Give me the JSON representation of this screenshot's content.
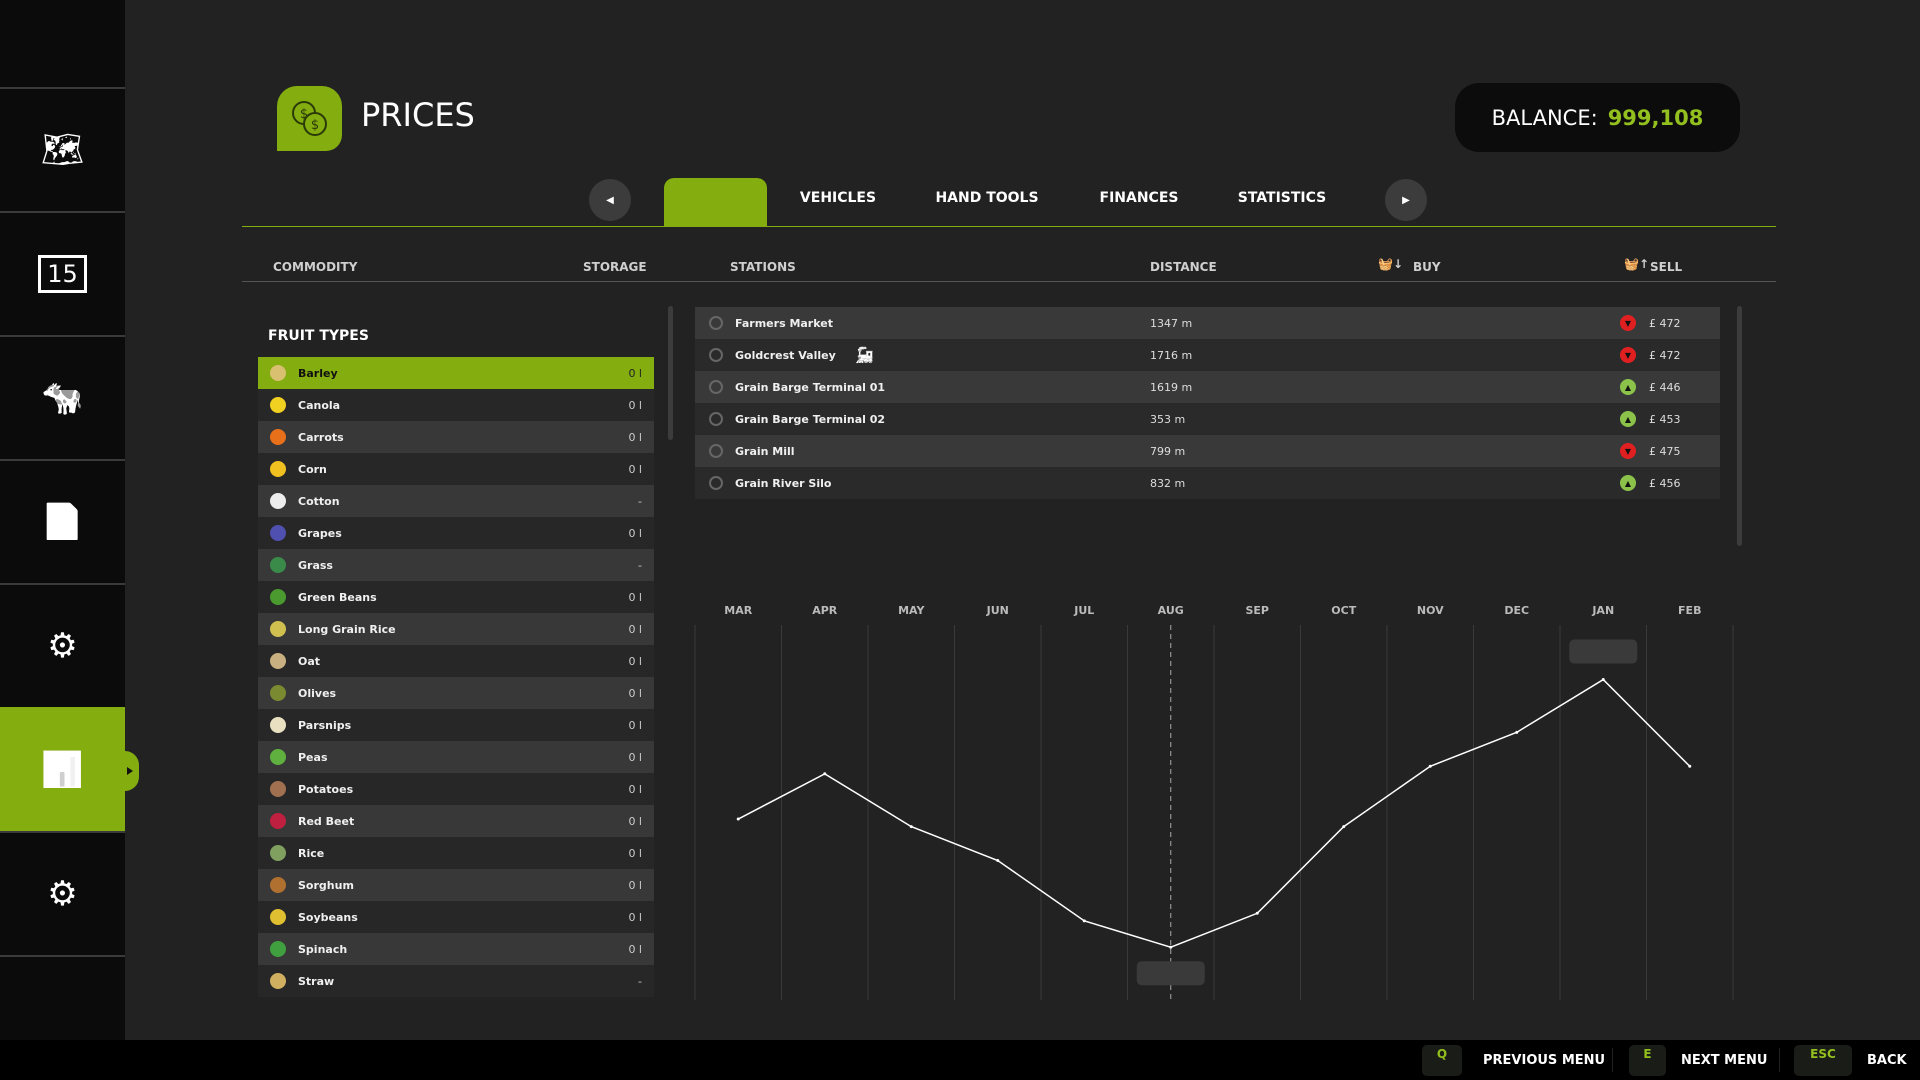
{
  "sidebar": {
    "items": [
      {
        "name": "map",
        "icon": "map-pin-icon",
        "glyph": "🗺"
      },
      {
        "name": "calendar",
        "icon": "calendar-icon",
        "glyph": "15"
      },
      {
        "name": "animals",
        "icon": "cow-icon",
        "glyph": "🐄"
      },
      {
        "name": "contracts",
        "icon": "documents-icon",
        "glyph": "📄"
      },
      {
        "name": "production",
        "icon": "factory-icon",
        "glyph": "⚙"
      },
      {
        "name": "prices",
        "icon": "chart-icon",
        "glyph": "📊",
        "active": true
      },
      {
        "name": "settings",
        "icon": "settings-icon",
        "glyph": "⚙"
      }
    ]
  },
  "header": {
    "title": "PRICES",
    "balance_label": "BALANCE:",
    "balance_value": "999,108"
  },
  "tabs": [
    {
      "label": "VEHICLES"
    },
    {
      "label": "HAND TOOLS"
    },
    {
      "label": "FINANCES"
    },
    {
      "label": "STATISTICS"
    }
  ],
  "columns": {
    "commodity": "COMMODITY",
    "storage": "STORAGE",
    "stations": "STATIONS",
    "distance": "DISTANCE",
    "buy": "BUY",
    "sell": "SELL"
  },
  "fruit_section": "FRUIT TYPES",
  "commodities": [
    {
      "name": "Barley",
      "qty": "0 l",
      "color": "#d8c070",
      "selected": true
    },
    {
      "name": "Canola",
      "qty": "0 l",
      "color": "#f0d020"
    },
    {
      "name": "Carrots",
      "qty": "0 l",
      "color": "#e8701a"
    },
    {
      "name": "Corn",
      "qty": "0 l",
      "color": "#f0c020"
    },
    {
      "name": "Cotton",
      "qty": "-",
      "color": "#eeeeee"
    },
    {
      "name": "Grapes",
      "qty": "0 l",
      "color": "#5050b0"
    },
    {
      "name": "Grass",
      "qty": "-",
      "color": "#3a8a4a"
    },
    {
      "name": "Green Beans",
      "qty": "0 l",
      "color": "#4a9a30"
    },
    {
      "name": "Long Grain Rice",
      "qty": "0 l",
      "color": "#d0c050"
    },
    {
      "name": "Oat",
      "qty": "0 l",
      "color": "#c8b080"
    },
    {
      "name": "Olives",
      "qty": "0 l",
      "color": "#7a8a30"
    },
    {
      "name": "Parsnips",
      "qty": "0 l",
      "color": "#e8e0c0"
    },
    {
      "name": "Peas",
      "qty": "0 l",
      "color": "#60b040"
    },
    {
      "name": "Potatoes",
      "qty": "0 l",
      "color": "#a07050"
    },
    {
      "name": "Red Beet",
      "qty": "0 l",
      "color": "#c02040"
    },
    {
      "name": "Rice",
      "qty": "0 l",
      "color": "#80a060"
    },
    {
      "name": "Sorghum",
      "qty": "0 l",
      "color": "#b07030"
    },
    {
      "name": "Soybeans",
      "qty": "0 l",
      "color": "#e0c030"
    },
    {
      "name": "Spinach",
      "qty": "0 l",
      "color": "#40a040"
    },
    {
      "name": "Straw",
      "qty": "-",
      "color": "#d0b060"
    }
  ],
  "stations": [
    {
      "name": "Farmers Market",
      "distance": "1347 m",
      "trend": "down",
      "price": "£ 472"
    },
    {
      "name": "Goldcrest Valley",
      "distance": "1716 m",
      "trend": "down",
      "price": "£ 472",
      "train": true
    },
    {
      "name": "Grain Barge Terminal 01",
      "distance": "1619 m",
      "trend": "up",
      "price": "£ 446"
    },
    {
      "name": "Grain Barge Terminal 02",
      "distance": "353 m",
      "trend": "up",
      "price": "£ 453"
    },
    {
      "name": "Grain Mill",
      "distance": "799 m",
      "trend": "down",
      "price": "£ 475"
    },
    {
      "name": "Grain River Silo",
      "distance": "832 m",
      "trend": "up",
      "price": "£ 456"
    }
  ],
  "colors": {
    "accent": "#84ad0f",
    "up": "#8bc34a",
    "down": "#e02020"
  },
  "chart_data": {
    "type": "line",
    "categories": [
      "MAR",
      "APR",
      "MAY",
      "JUN",
      "JUL",
      "AUG",
      "SEP",
      "OCT",
      "NOV",
      "DEC",
      "JAN",
      "FEB"
    ],
    "values": [
      48,
      60,
      46,
      37,
      21,
      14,
      23,
      46,
      62,
      71,
      85,
      62
    ],
    "ylim": [
      0,
      100
    ],
    "current_month": "AUG",
    "grid": true,
    "xlabel": "",
    "ylabel": ""
  },
  "footer": [
    {
      "key": "Q",
      "label": "PREVIOUS MENU"
    },
    {
      "key": "E",
      "label": "NEXT MENU"
    },
    {
      "key": "ESC",
      "label": "BACK"
    }
  ]
}
